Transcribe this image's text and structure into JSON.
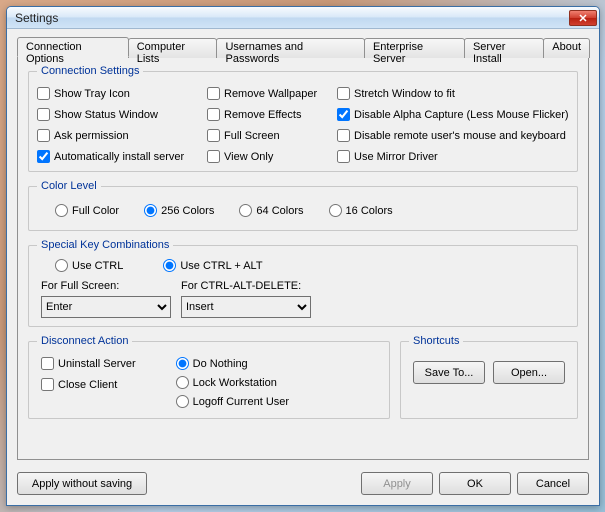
{
  "window": {
    "title": "Settings"
  },
  "tabs": [
    {
      "label": "Connection Options"
    },
    {
      "label": "Computer Lists"
    },
    {
      "label": "Usernames and Passwords"
    },
    {
      "label": "Enterprise Server"
    },
    {
      "label": "Server Install"
    },
    {
      "label": "About"
    }
  ],
  "conn": {
    "legend": "Connection Settings",
    "col1": [
      {
        "label": "Show Tray Icon",
        "checked": false
      },
      {
        "label": "Show Status Window",
        "checked": false
      },
      {
        "label": "Ask permission",
        "checked": false
      },
      {
        "label": "Automatically install server",
        "checked": true
      }
    ],
    "col2": [
      {
        "label": "Remove Wallpaper",
        "checked": false
      },
      {
        "label": "Remove Effects",
        "checked": false
      },
      {
        "label": "Full Screen",
        "checked": false
      },
      {
        "label": "View Only",
        "checked": false
      }
    ],
    "col3": [
      {
        "label": "Stretch Window to fit",
        "checked": false
      },
      {
        "label": "Disable Alpha Capture (Less Mouse Flicker)",
        "checked": true
      },
      {
        "label": "Disable remote user's mouse and keyboard",
        "checked": false
      },
      {
        "label": "Use Mirror Driver",
        "checked": false
      }
    ]
  },
  "color": {
    "legend": "Color Level",
    "options": [
      "Full Color",
      "256 Colors",
      "64 Colors",
      "16 Colors"
    ],
    "selected": "256 Colors"
  },
  "skc": {
    "legend": "Special Key Combinations",
    "options": [
      "Use CTRL",
      "Use CTRL + ALT"
    ],
    "selected": "Use CTRL + ALT",
    "full_label": "For Full Screen:",
    "full_value": "Enter",
    "cad_label": "For CTRL-ALT-DELETE:",
    "cad_value": "Insert"
  },
  "disconnect": {
    "legend": "Disconnect Action",
    "checks": [
      {
        "label": "Uninstall Server",
        "checked": false
      },
      {
        "label": "Close Client",
        "checked": false
      }
    ],
    "radios": [
      "Do Nothing",
      "Lock Workstation",
      "Logoff Current User"
    ],
    "selected": "Do Nothing"
  },
  "shortcuts": {
    "legend": "Shortcuts",
    "save": "Save To...",
    "open": "Open..."
  },
  "footer": {
    "apply_ws": "Apply without saving",
    "apply": "Apply",
    "ok": "OK",
    "cancel": "Cancel"
  }
}
